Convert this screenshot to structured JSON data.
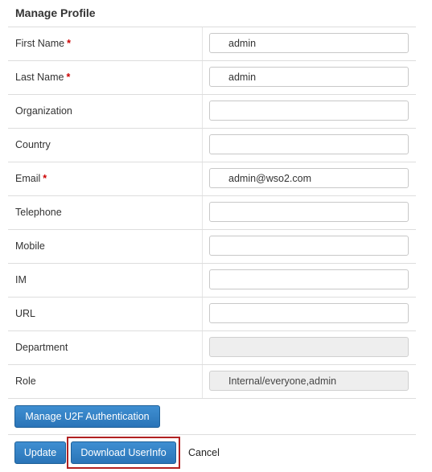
{
  "page": {
    "title": "Manage Profile"
  },
  "fields": [
    {
      "label": "First Name",
      "required": "*",
      "value": "admin"
    },
    {
      "label": "Last Name",
      "required": "*",
      "value": "admin"
    },
    {
      "label": "Organization",
      "value": ""
    },
    {
      "label": "Country",
      "value": ""
    },
    {
      "label": "Email",
      "required": "*",
      "value": "admin@wso2.com"
    },
    {
      "label": "Telephone",
      "value": ""
    },
    {
      "label": "Mobile",
      "value": ""
    },
    {
      "label": "IM",
      "value": ""
    },
    {
      "label": "URL",
      "value": ""
    },
    {
      "label": "Department",
      "value": "",
      "readonly": true
    },
    {
      "label": "Role",
      "value": "Internal/everyone,admin",
      "readonly": true
    }
  ],
  "buttons": {
    "u2f_label": "Manage U2F Authentication",
    "update_label": "Update",
    "download_label": "Download UserInfo",
    "cancel_label": "Cancel"
  },
  "colors": {
    "button_blue": "#2a74b8",
    "required_red": "#cc0000",
    "highlight_red": "#b22222"
  }
}
